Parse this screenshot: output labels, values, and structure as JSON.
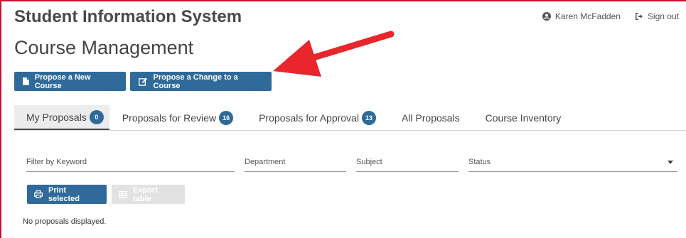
{
  "header": {
    "app_title": "Student Information System",
    "user_name": "Karen McFadden",
    "sign_out_label": "Sign out"
  },
  "page": {
    "title": "Course Management"
  },
  "actions": {
    "propose_new_label": "Propose a New Course",
    "propose_change_label": "Propose a Change to a Course"
  },
  "tabs": [
    {
      "label": "My Proposals",
      "badge": "0",
      "active": true
    },
    {
      "label": "Proposals for Review",
      "badge": "16"
    },
    {
      "label": "Proposals for Approval",
      "badge": "13"
    },
    {
      "label": "All Proposals"
    },
    {
      "label": "Course Inventory"
    }
  ],
  "filters": {
    "keyword_placeholder": "Filter by Keyword",
    "department_placeholder": "Department",
    "subject_placeholder": "Subject",
    "status_placeholder": "Status"
  },
  "table_actions": {
    "print_label": "Print selected",
    "export_label": "Export table"
  },
  "results": {
    "empty_message": "No proposals displayed."
  },
  "colors": {
    "primary": "#2f6a9a",
    "annotation_arrow": "#e8262b",
    "frame_border": "#c8102e"
  },
  "icons": [
    "user-circle-icon",
    "sign-out-icon",
    "document-icon",
    "edit-icon",
    "printer-icon",
    "table-icon",
    "caret-down-icon",
    "annotation-arrow"
  ]
}
